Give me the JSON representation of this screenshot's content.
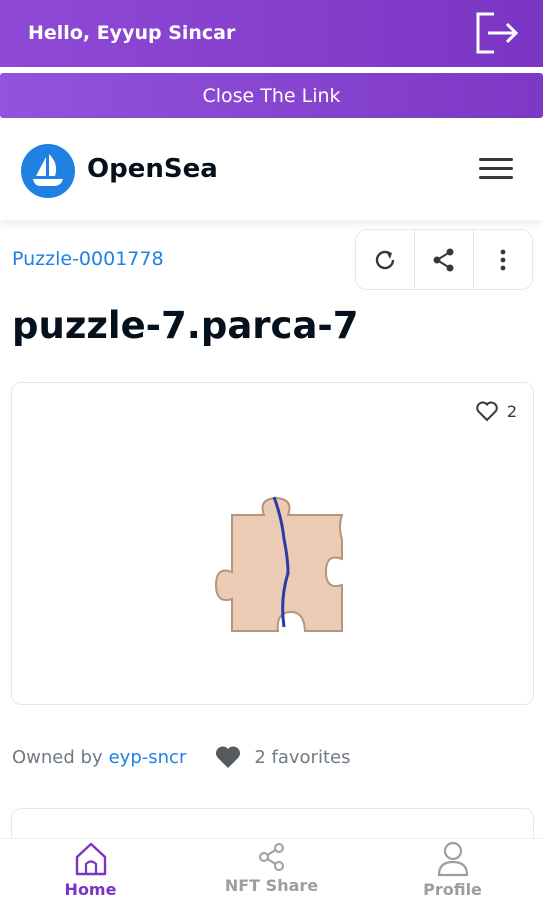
{
  "header": {
    "greeting": "Hello, Eyyup Sincar",
    "close_link_label": "Close The Link"
  },
  "opensea": {
    "brand": "OpenSea"
  },
  "item": {
    "collection": "Puzzle-0001778",
    "title": "puzzle-7.parca-7",
    "favorite_count": "2",
    "owned_by_label": "Owned by",
    "owner": "eyp-sncr",
    "favorites_text": "2 favorites"
  },
  "bottom_nav": {
    "items": [
      {
        "label": "Home",
        "icon": "home-icon",
        "active": true
      },
      {
        "label": "NFT Share",
        "icon": "share-icon",
        "active": false
      },
      {
        "label": "Profile",
        "icon": "profile-icon",
        "active": false
      }
    ]
  },
  "colors": {
    "primary_purple": "#7b35c4",
    "opensea_blue": "#2081e2",
    "puzzle_piece": "#ebcbb3"
  }
}
